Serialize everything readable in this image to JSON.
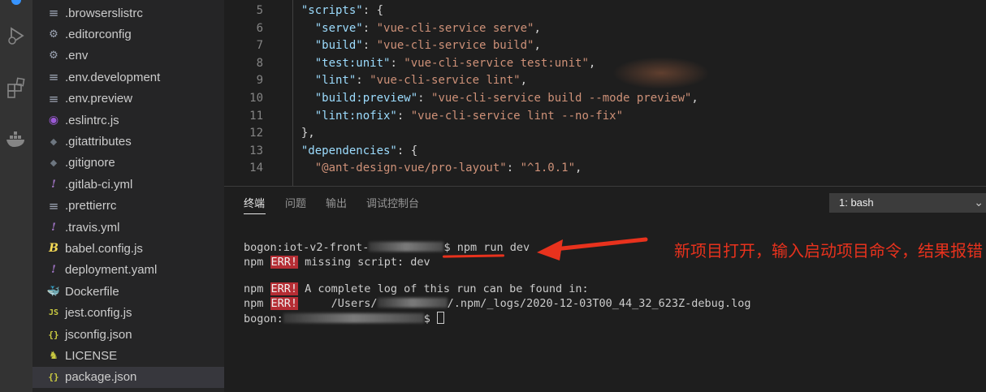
{
  "explorer": {
    "files": [
      {
        "name": ".browserslistrc",
        "icon": "lines-icon"
      },
      {
        "name": ".editorconfig",
        "icon": "gear-icon"
      },
      {
        "name": ".env",
        "icon": "gear-icon"
      },
      {
        "name": ".env.development",
        "icon": "lines-icon"
      },
      {
        "name": ".env.preview",
        "icon": "lines-icon"
      },
      {
        "name": ".eslintrc.js",
        "icon": "eslint-icon"
      },
      {
        "name": ".gitattributes",
        "icon": "git-icon"
      },
      {
        "name": ".gitignore",
        "icon": "git-icon"
      },
      {
        "name": ".gitlab-ci.yml",
        "icon": "yaml-icon"
      },
      {
        "name": ".prettierrc",
        "icon": "lines-icon"
      },
      {
        "name": ".travis.yml",
        "icon": "yaml-icon"
      },
      {
        "name": "babel.config.js",
        "icon": "babel-icon"
      },
      {
        "name": "deployment.yaml",
        "icon": "yaml-icon"
      },
      {
        "name": "Dockerfile",
        "icon": "docker-icon"
      },
      {
        "name": "jest.config.js",
        "icon": "jest-icon"
      },
      {
        "name": "jsconfig.json",
        "icon": "json-icon"
      },
      {
        "name": "LICENSE",
        "icon": "license-icon"
      },
      {
        "name": "package.json",
        "icon": "json-icon",
        "selected": true
      }
    ],
    "glyphs": {
      "lines": "≡",
      "gear": "⚙",
      "eslint": "◉",
      "git": "◆",
      "bang": "!",
      "babel": "B",
      "docker": "🐳",
      "jest": "JS",
      "json": "{}",
      "license": "♞"
    }
  },
  "editor": {
    "lines": [
      {
        "num": "5",
        "indent": "  ",
        "parts": [
          [
            "k",
            "\"scripts\""
          ],
          [
            "p",
            ": {"
          ]
        ]
      },
      {
        "num": "6",
        "indent": "    ",
        "parts": [
          [
            "k",
            "\"serve\""
          ],
          [
            "p",
            ": "
          ],
          [
            "s",
            "\"vue-cli-service serve\""
          ],
          [
            "p",
            ","
          ]
        ]
      },
      {
        "num": "7",
        "indent": "    ",
        "parts": [
          [
            "k",
            "\"build\""
          ],
          [
            "p",
            ": "
          ],
          [
            "s",
            "\"vue-cli-service build\""
          ],
          [
            "p",
            ","
          ]
        ]
      },
      {
        "num": "8",
        "indent": "    ",
        "parts": [
          [
            "k",
            "\"test:unit\""
          ],
          [
            "p",
            ": "
          ],
          [
            "s",
            "\"vue-cli-service test:unit\""
          ],
          [
            "p",
            ","
          ]
        ]
      },
      {
        "num": "9",
        "indent": "    ",
        "parts": [
          [
            "k",
            "\"lint\""
          ],
          [
            "p",
            ": "
          ],
          [
            "s",
            "\"vue-cli-service lint\""
          ],
          [
            "p",
            ","
          ]
        ]
      },
      {
        "num": "10",
        "indent": "    ",
        "parts": [
          [
            "k",
            "\"build:preview\""
          ],
          [
            "p",
            ": "
          ],
          [
            "s",
            "\"vue-cli-service build --mode preview\""
          ],
          [
            "p",
            ","
          ]
        ]
      },
      {
        "num": "11",
        "indent": "    ",
        "parts": [
          [
            "k",
            "\"lint:nofix\""
          ],
          [
            "p",
            ": "
          ],
          [
            "s",
            "\"vue-cli-service lint --no-fix\""
          ]
        ]
      },
      {
        "num": "12",
        "indent": "  ",
        "parts": [
          [
            "p",
            "},"
          ]
        ]
      },
      {
        "num": "13",
        "indent": "  ",
        "parts": [
          [
            "k",
            "\"dependencies\""
          ],
          [
            "p",
            ": {"
          ]
        ]
      },
      {
        "num": "14",
        "indent": "    ",
        "parts": [
          [
            "s",
            "\"@ant-design-vue/pro-layout\""
          ],
          [
            "p",
            ": "
          ],
          [
            "s",
            "\"^1.0.1\""
          ],
          [
            "p",
            ","
          ]
        ]
      }
    ]
  },
  "panel": {
    "tabs": [
      "终端",
      "问题",
      "输出",
      "调试控制台"
    ],
    "active_tab": "终端",
    "terminal_select": "1: bash"
  },
  "terminal": {
    "line1": {
      "prompt": "bogon:iot-v2-front-",
      "prompt_end": "$ ",
      "command": "npm run dev"
    },
    "line2": {
      "prefix": "npm ",
      "err": "ERR!",
      "text": " missing script: dev"
    },
    "line3": {
      "prefix": "npm ",
      "err": "ERR!",
      "text": " A complete log of this run can be found in:"
    },
    "line4": {
      "prefix": "npm ",
      "err": "ERR!",
      "path_start": "     /Users/",
      "path_end": "/.npm/_logs/2020-12-03T00_44_32_623Z-debug.log"
    },
    "line5": {
      "prompt": "bogon:",
      "prompt_end": "$ "
    }
  },
  "annotation": {
    "text": "新项目打开，输入启动项目命令，结果报错",
    "color": "#e8321d"
  }
}
